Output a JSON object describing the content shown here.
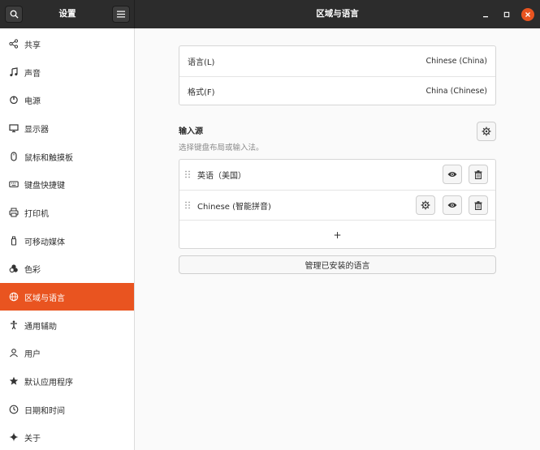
{
  "window": {
    "sidebar_title": "设置",
    "title": "区域与语言"
  },
  "sidebar": {
    "items": [
      {
        "label": "共享",
        "icon": "share-icon"
      },
      {
        "label": "声音",
        "icon": "music-note-icon"
      },
      {
        "label": "电源",
        "icon": "power-icon"
      },
      {
        "label": "显示器",
        "icon": "display-icon"
      },
      {
        "label": "鼠标和触摸板",
        "icon": "mouse-icon"
      },
      {
        "label": "键盘快捷键",
        "icon": "keyboard-icon"
      },
      {
        "label": "打印机",
        "icon": "printer-icon"
      },
      {
        "label": "可移动媒体",
        "icon": "removable-media-icon"
      },
      {
        "label": "色彩",
        "icon": "color-icon"
      },
      {
        "label": "区域与语言",
        "icon": "globe-icon",
        "active": true
      },
      {
        "label": "通用辅助",
        "icon": "accessibility-icon"
      },
      {
        "label": "用户",
        "icon": "user-icon"
      },
      {
        "label": "默认应用程序",
        "icon": "star-icon"
      },
      {
        "label": "日期和时间",
        "icon": "clock-icon"
      },
      {
        "label": "关于",
        "icon": "sparkle-icon"
      }
    ]
  },
  "region": {
    "language_label": "语言(L)",
    "language_value": "Chinese (China)",
    "formats_label": "格式(F)",
    "formats_value": "China (Chinese)"
  },
  "input_sources": {
    "title": "输入源",
    "subtitle": "选择键盘布局或输入法。",
    "items": [
      {
        "label": "英语（美国）"
      },
      {
        "label": "Chinese (智能拼音)"
      }
    ],
    "add_label": "+",
    "manage_label": "管理已安装的语言"
  },
  "colors": {
    "accent": "#e95420",
    "headerbar": "#2c2c2c"
  }
}
